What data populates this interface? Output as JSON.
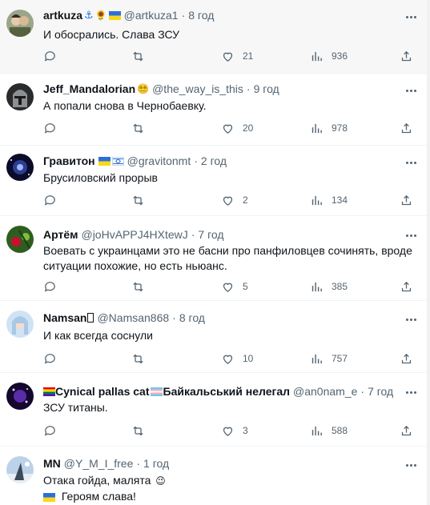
{
  "tweets": [
    {
      "name": "artkuza",
      "name_badges": [
        "anchor-icon",
        "sunflower-emoji",
        "ukraine-flag"
      ],
      "handle": "@artkuza1",
      "dot": "·",
      "time": "8 год",
      "lines": [
        "И обосрались. Слава ЗСУ"
      ],
      "replies": "",
      "retweets": "",
      "likes": "21",
      "views": "936",
      "highlighted": true
    },
    {
      "name": "Jeff_Mandalorian",
      "name_badges": [
        "emoji-face"
      ],
      "handle": "@the_way_is_this",
      "dot": "·",
      "time": "9 год",
      "lines": [
        "А попали снова в Чернобаевку."
      ],
      "replies": "",
      "retweets": "",
      "likes": "20",
      "views": "978"
    },
    {
      "name": "Гравитон",
      "name_badges": [
        "ukraine-flag",
        "israel-flag"
      ],
      "handle": "@gravitonmt",
      "dot": "·",
      "time": "2 год",
      "lines": [
        "Брусиловский прорыв"
      ],
      "replies": "",
      "retweets": "",
      "likes": "2",
      "views": "134"
    },
    {
      "name": "Артём",
      "name_badges": [],
      "handle": "@joHvAPPJ4HXtewJ",
      "dot": "·",
      "time": "7 год",
      "lines": [
        "Воевать с украинцами это не басни про панфиловцев сочинять, вроде",
        "ситуации похожие, но есть ньюанс."
      ],
      "replies": "",
      "retweets": "",
      "likes": "5",
      "views": "385"
    },
    {
      "name": "Namsan",
      "name_badges": [
        "unknown-glyph"
      ],
      "handle": "@Namsan868",
      "dot": "·",
      "time": "8 год",
      "lines": [
        "И как всегда соснули"
      ],
      "replies": "",
      "retweets": "",
      "likes": "10",
      "views": "757"
    },
    {
      "name_prefix_badge": "rainbow-flag",
      "name": "Cynical pallas cat",
      "name_mid_badge": "transgender-flag",
      "name_suffix": "Байкальський нелегал",
      "handle": "@an0nam_e",
      "dot": "·",
      "time": "7 год",
      "lines": [
        "ЗСУ титаны."
      ],
      "replies": "",
      "retweets": "",
      "likes": "3",
      "views": "588"
    },
    {
      "name": "MN",
      "name_badges": [],
      "handle": "@Y_M_I_free",
      "dot": "·",
      "time": "1 год",
      "lines": [
        "Отака гойда, малята",
        "Героям слава!"
      ],
      "line_emojis": [
        "winking-face-emoji",
        "ukraine-flag"
      ],
      "replies": "",
      "retweets": "",
      "likes": "",
      "views": ""
    }
  ],
  "colors": {
    "text": "#0f1419",
    "muted": "#536471",
    "divider": "#eff3f4",
    "highlight_bg": "#f7f7f7"
  }
}
